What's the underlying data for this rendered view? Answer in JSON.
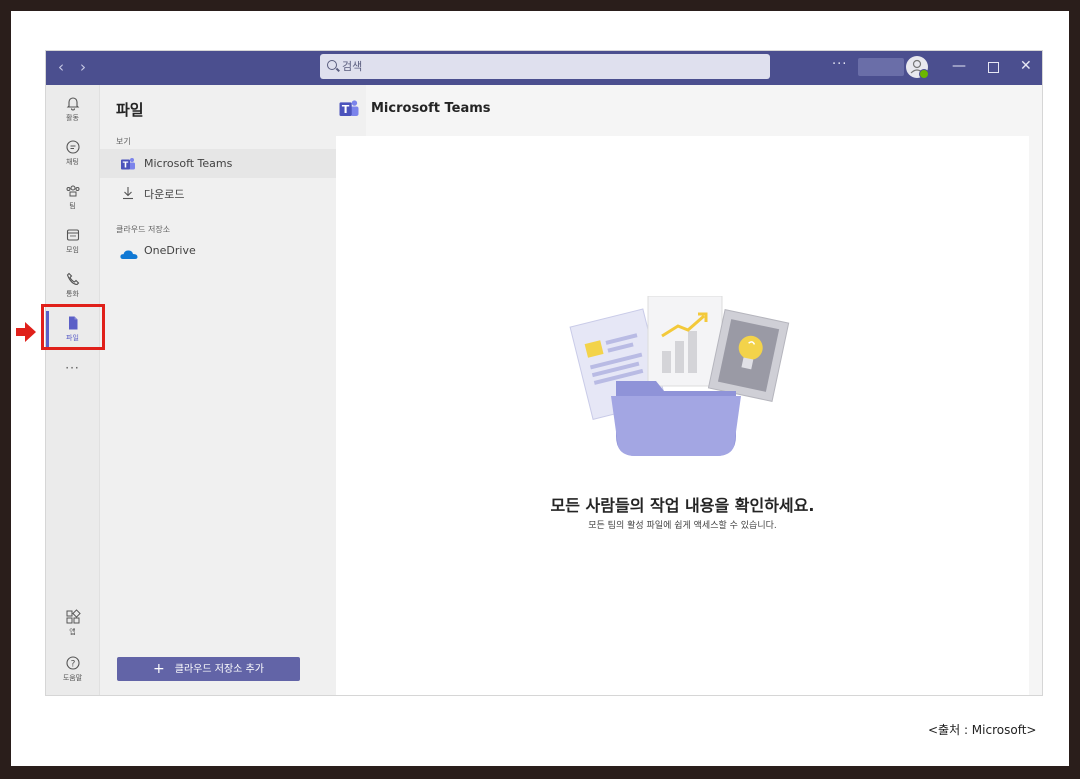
{
  "titlebar": {
    "search_placeholder": "검색",
    "more_label": "···"
  },
  "rail": {
    "items": [
      {
        "label": "활동",
        "icon": "bell-icon"
      },
      {
        "label": "채팅",
        "icon": "chat-icon"
      },
      {
        "label": "팀",
        "icon": "teams-icon"
      },
      {
        "label": "모임",
        "icon": "calendar-icon"
      },
      {
        "label": "통화",
        "icon": "phone-icon"
      },
      {
        "label": "파일",
        "icon": "file-icon",
        "selected": true
      }
    ],
    "more": "···",
    "apps_label": "앱",
    "help_label": "도움말"
  },
  "panel": {
    "title": "파일",
    "views_label": "보기",
    "views": [
      {
        "label": "Microsoft Teams",
        "icon": "teams-logo-icon",
        "active": true
      },
      {
        "label": "다운로드",
        "icon": "download-icon"
      }
    ],
    "cloud_label": "클라우드 저장소",
    "cloud": [
      {
        "label": "OneDrive",
        "icon": "onedrive-icon"
      }
    ],
    "add_button": "클라우드 저장소 추가"
  },
  "main": {
    "title": "Microsoft Teams",
    "empty_title": "모든 사람들의 작업 내용을 확인하세요.",
    "empty_subtitle": "모든 팀의 활성 파일에 쉽게 액세스할 수 있습니다."
  },
  "source_caption": "<출처 : Microsoft>",
  "colors": {
    "accent": "#5b5fc7",
    "titlebar": "#4b4f8f",
    "highlight": "#e0201a"
  }
}
